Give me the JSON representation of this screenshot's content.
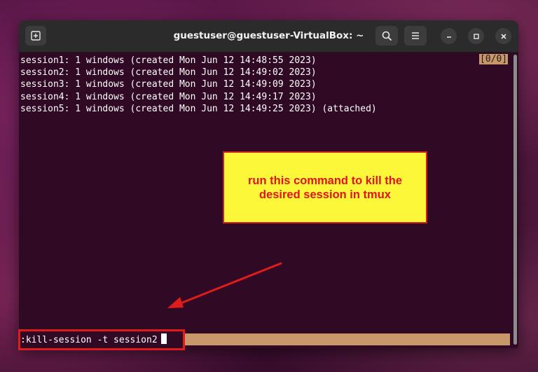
{
  "window": {
    "title": "guestuser@guestuser-VirtualBox: ~"
  },
  "terminal": {
    "lines": [
      "session1: 1 windows (created Mon Jun 12 14:48:55 2023)",
      "session2: 1 windows (created Mon Jun 12 14:49:02 2023)",
      "session3: 1 windows (created Mon Jun 12 14:49:09 2023)",
      "session4: 1 windows (created Mon Jun 12 14:49:17 2023)",
      "session5: 1 windows (created Mon Jun 12 14:49:25 2023) (attached)"
    ],
    "indicator": "[0/0]",
    "command": ":kill-session -t session2"
  },
  "annotation": {
    "callout_text": "run this command to kill the desired session in tmux"
  },
  "icons": {
    "new_tab": "new-tab-icon",
    "search": "search-icon",
    "menu": "hamburger-menu-icon",
    "minimize": "minimize-icon",
    "maximize": "maximize-icon",
    "close": "close-icon"
  },
  "colors": {
    "terminal_bg": "#300a24",
    "status_bar": "#c8976a",
    "callout_bg": "#fdf73a",
    "annotation_red": "#e01b1b"
  }
}
